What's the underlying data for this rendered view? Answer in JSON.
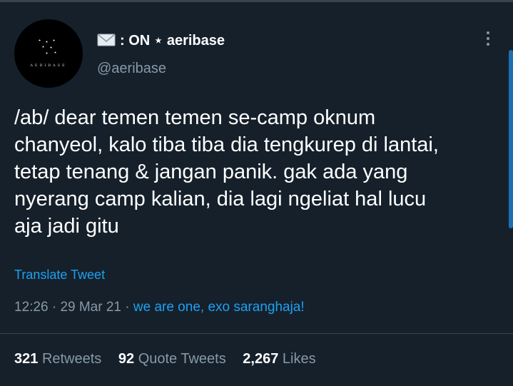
{
  "tweet": {
    "display_name": ": ON ⋆ aeribase",
    "handle": "@aeribase",
    "avatar_brand": "AERIBASE",
    "body_lines": [
      "/ab/ dear temen temen se-camp oknum",
      "chanyeol, kalo tiba tiba dia tengkurep di lantai,",
      "tetap tenang & jangan panik. gak ada yang",
      "nyerang camp kalian, dia lagi ngeliat hal lucu",
      "aja jadi gitu"
    ],
    "translate_label": "Translate Tweet",
    "time": "12:26",
    "date": "29 Mar 21",
    "source": "we are one, exo saranghaja!",
    "stats": {
      "retweets_count": "321",
      "retweets_label": "Retweets",
      "quotes_count": "92",
      "quotes_label": "Quote Tweets",
      "likes_count": "2,267",
      "likes_label": "Likes"
    }
  },
  "colors": {
    "background": "#15202b",
    "text_primary": "#ffffff",
    "text_secondary": "#8899a6",
    "link": "#1da1f2",
    "divider": "#38444d"
  },
  "icons": [
    "envelope-icon",
    "more-options-icon"
  ]
}
